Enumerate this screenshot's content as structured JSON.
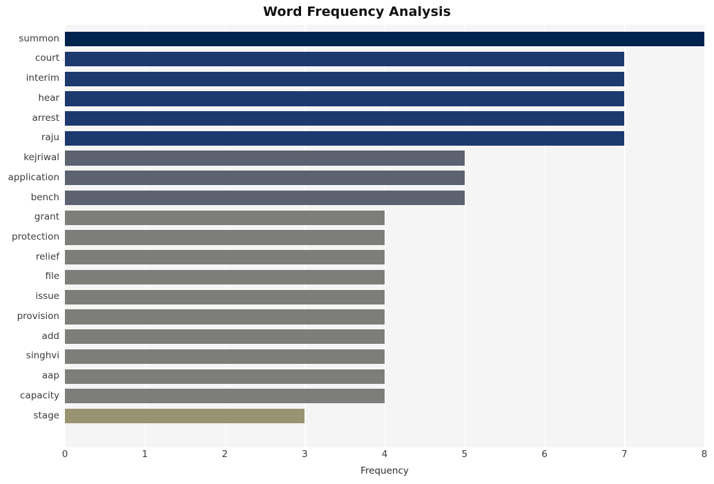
{
  "chart_data": {
    "type": "bar",
    "orientation": "horizontal",
    "title": "Word Frequency Analysis",
    "xlabel": "Frequency",
    "ylabel": "",
    "xlim": [
      0,
      8
    ],
    "ylim": null,
    "grid": true,
    "grid_axis": "x",
    "legend": null,
    "categories": [
      "summon",
      "court",
      "interim",
      "hear",
      "arrest",
      "raju",
      "kejriwal",
      "application",
      "bench",
      "grant",
      "protection",
      "relief",
      "file",
      "issue",
      "provision",
      "add",
      "singhvi",
      "aap",
      "capacity",
      "stage"
    ],
    "values": [
      8,
      7,
      7,
      7,
      7,
      7,
      5,
      5,
      5,
      4,
      4,
      4,
      4,
      4,
      4,
      4,
      4,
      4,
      4,
      3
    ],
    "bar_colors": [
      "#00234d",
      "#1d3a6e",
      "#1d3a6e",
      "#1d3a6e",
      "#1d3a6e",
      "#1d3a6e",
      "#5d6270",
      "#5d6270",
      "#5d6270",
      "#7d7d79",
      "#7d7d79",
      "#7d7d79",
      "#7d7d79",
      "#7d7d79",
      "#7d7d79",
      "#7d7d79",
      "#7d7d79",
      "#7d7d79",
      "#7d7d79",
      "#9a9372"
    ],
    "x_ticks": [
      0,
      1,
      2,
      3,
      4,
      5,
      6,
      7,
      8
    ],
    "x_tick_labels": [
      "0",
      "1",
      "2",
      "3",
      "4",
      "5",
      "6",
      "7",
      "8"
    ],
    "plot_background": "#f5f5f6",
    "figure_background": "#ffffff",
    "gridline_color": "#ffffff",
    "tick_label_color": "#3b3b3b",
    "title_color": "#111111"
  }
}
